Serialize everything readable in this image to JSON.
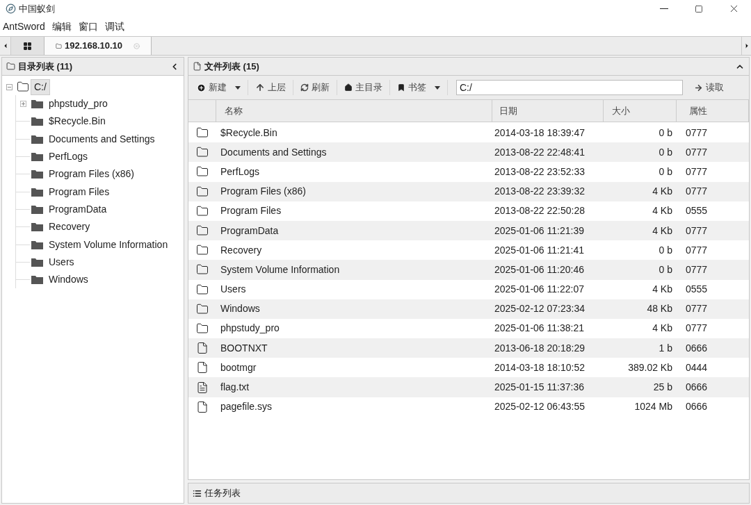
{
  "window": {
    "title": "中国蚁剑"
  },
  "menu": [
    "AntSword",
    "编辑",
    "窗口",
    "调试"
  ],
  "tabs": [
    {
      "kind": "home",
      "selected": false
    },
    {
      "kind": "folder",
      "label": "192.168.10.10",
      "selected": true
    }
  ],
  "directory_panel": {
    "title": "目录列表 (11)",
    "tree": {
      "label": "C:/",
      "expanded": true,
      "selected": true,
      "children": [
        {
          "label": "phpstudy_pro",
          "kind": "expandable"
        },
        {
          "label": "$Recycle.Bin",
          "kind": "leaf"
        },
        {
          "label": "Documents and Settings",
          "kind": "leaf"
        },
        {
          "label": "PerfLogs",
          "kind": "leaf"
        },
        {
          "label": "Program Files (x86)",
          "kind": "leaf"
        },
        {
          "label": "Program Files",
          "kind": "leaf"
        },
        {
          "label": "ProgramData",
          "kind": "leaf"
        },
        {
          "label": "Recovery",
          "kind": "leaf"
        },
        {
          "label": "System Volume Information",
          "kind": "leaf"
        },
        {
          "label": "Users",
          "kind": "leaf"
        },
        {
          "label": "Windows",
          "kind": "leaf"
        }
      ]
    }
  },
  "file_panel": {
    "title": "文件列表 (15)",
    "toolbar": [
      {
        "kind": "new",
        "label": "新建",
        "dropdown": true
      },
      {
        "kind": "up",
        "label": "上层",
        "dropdown": false
      },
      {
        "kind": "refresh",
        "label": "刷新",
        "dropdown": false
      },
      {
        "kind": "home",
        "label": "主目录",
        "dropdown": false
      },
      {
        "kind": "bookmark",
        "label": "书签",
        "dropdown": true
      }
    ],
    "path": "C:/",
    "read_button": "读取",
    "columns": [
      "名称",
      "日期",
      "大小",
      "属性"
    ],
    "rows": [
      {
        "kind": "folder",
        "name": "$Recycle.Bin",
        "date": "2014-03-18 18:39:47",
        "size": "0 b",
        "attr": "0777"
      },
      {
        "kind": "folder",
        "name": "Documents and Settings",
        "date": "2013-08-22 22:48:41",
        "size": "0 b",
        "attr": "0777"
      },
      {
        "kind": "folder",
        "name": "PerfLogs",
        "date": "2013-08-22 23:52:33",
        "size": "0 b",
        "attr": "0777"
      },
      {
        "kind": "folder",
        "name": "Program Files (x86)",
        "date": "2013-08-22 23:39:32",
        "size": "4 Kb",
        "attr": "0777"
      },
      {
        "kind": "folder",
        "name": "Program Files",
        "date": "2013-08-22 22:50:28",
        "size": "4 Kb",
        "attr": "0555"
      },
      {
        "kind": "folder",
        "name": "ProgramData",
        "date": "2025-01-06 11:21:39",
        "size": "4 Kb",
        "attr": "0777"
      },
      {
        "kind": "folder",
        "name": "Recovery",
        "date": "2025-01-06 11:21:41",
        "size": "0 b",
        "attr": "0777"
      },
      {
        "kind": "folder",
        "name": "System Volume Information",
        "date": "2025-01-06 11:20:46",
        "size": "0 b",
        "attr": "0777"
      },
      {
        "kind": "folder",
        "name": "Users",
        "date": "2025-01-06 11:22:07",
        "size": "4 Kb",
        "attr": "0555"
      },
      {
        "kind": "folder",
        "name": "Windows",
        "date": "2025-02-12 07:23:34",
        "size": "48 Kb",
        "attr": "0777"
      },
      {
        "kind": "folder",
        "name": "phpstudy_pro",
        "date": "2025-01-06 11:38:21",
        "size": "4 Kb",
        "attr": "0777"
      },
      {
        "kind": "file",
        "name": "BOOTNXT",
        "date": "2013-06-18 20:18:29",
        "size": "1 b",
        "attr": "0666"
      },
      {
        "kind": "file",
        "name": "bootmgr",
        "date": "2014-03-18 18:10:52",
        "size": "389.02 Kb",
        "attr": "0444"
      },
      {
        "kind": "text",
        "name": "flag.txt",
        "date": "2025-01-15 11:37:36",
        "size": "25 b",
        "attr": "0666"
      },
      {
        "kind": "file",
        "name": "pagefile.sys",
        "date": "2025-02-12 06:43:55",
        "size": "1024 Mb",
        "attr": "0666"
      }
    ]
  },
  "task_panel": {
    "title": "任务列表"
  }
}
